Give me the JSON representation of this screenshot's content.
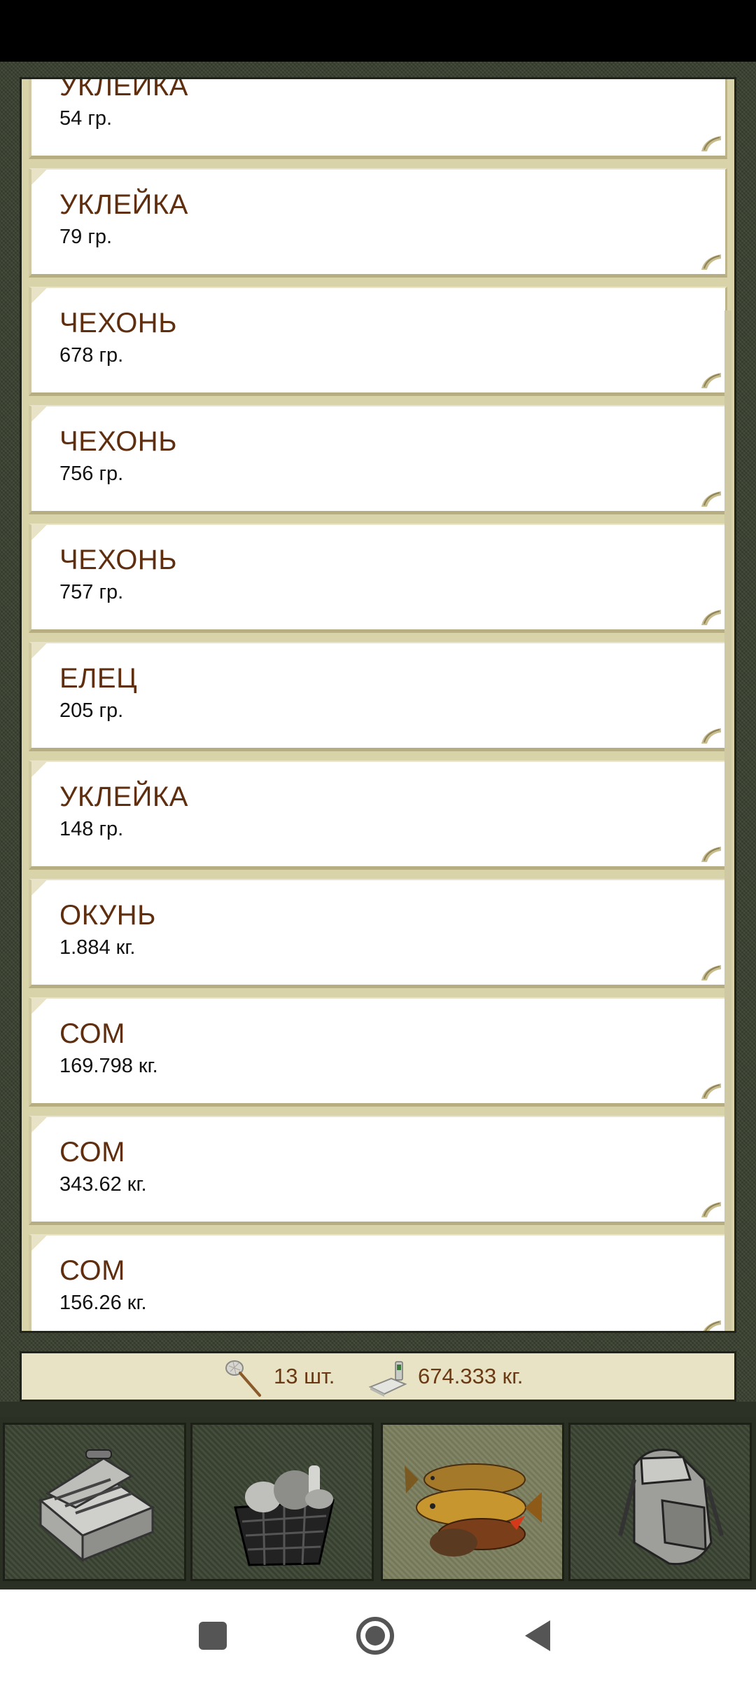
{
  "catch_list": [
    {
      "name": "УКЛЕЙКА",
      "weight": "54 гр."
    },
    {
      "name": "УКЛЕЙКА",
      "weight": "79 гр."
    },
    {
      "name": "ЧЕХОНЬ",
      "weight": "678 гр."
    },
    {
      "name": "ЧЕХОНЬ",
      "weight": "756 гр."
    },
    {
      "name": "ЧЕХОНЬ",
      "weight": "757 гр."
    },
    {
      "name": "ЕЛЕЦ",
      "weight": "205 гр."
    },
    {
      "name": "УКЛЕЙКА",
      "weight": "148 гр."
    },
    {
      "name": "ОКУНЬ",
      "weight": "1.884 кг."
    },
    {
      "name": "СОМ",
      "weight": "169.798 кг."
    },
    {
      "name": "СОМ",
      "weight": "343.62 кг."
    },
    {
      "name": "СОМ",
      "weight": "156.26 кг."
    }
  ],
  "summary": {
    "count": "13 шт.",
    "total_weight": "674.333 кг.",
    "count_icon": "landing-net-icon",
    "weight_icon": "scale-icon"
  },
  "tabs": [
    {
      "icon": "tackle-box-icon",
      "active": false
    },
    {
      "icon": "basket-icon",
      "active": false
    },
    {
      "icon": "fish-catch-icon",
      "active": true
    },
    {
      "icon": "backpack-icon",
      "active": false
    }
  ],
  "system_nav": [
    "recents-button",
    "home-button",
    "back-button"
  ]
}
